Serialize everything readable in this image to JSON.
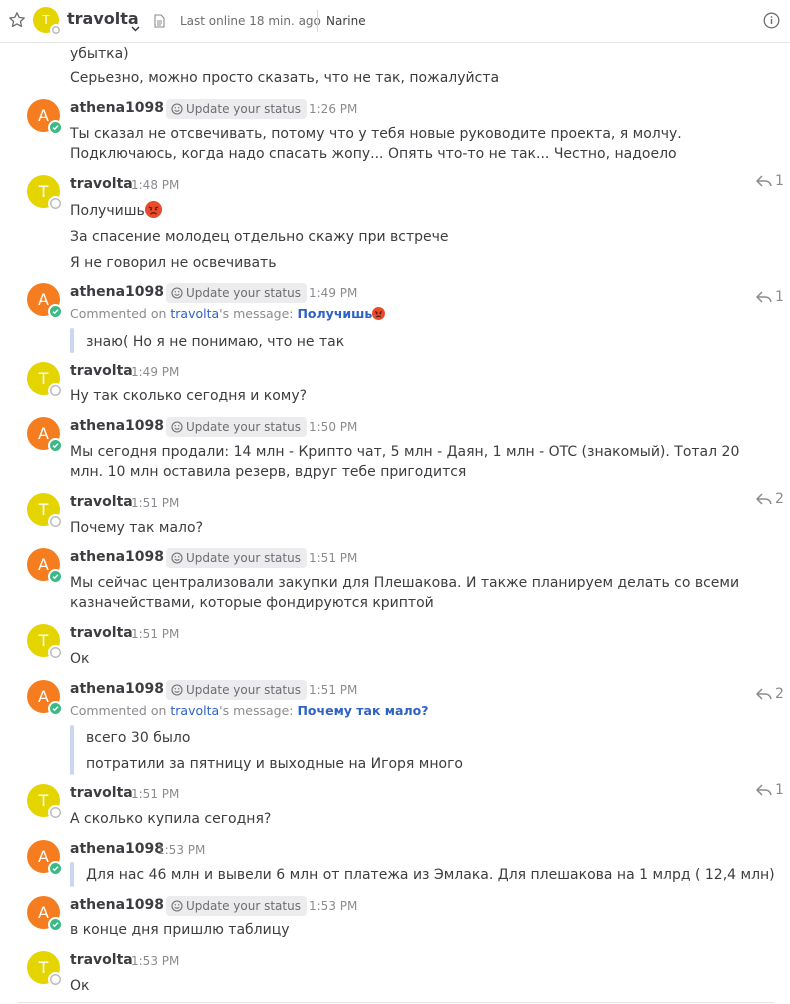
{
  "header": {
    "channel_name": "travolta",
    "avatar_letter": "T",
    "last_online": "Last online 18 min. ago",
    "user_name": "Narine"
  },
  "colors": {
    "athena_avatar": "#f57c1f",
    "travolta_avatar": "#e4d400",
    "online_status": "#3db887",
    "link": "#2f62c5",
    "quote_bar": "#c9d7f0"
  },
  "icons": {
    "favorite": "star-icon",
    "dropdown": "chevron-down-icon",
    "files": "file-icon",
    "info": "info-icon",
    "status": "smiley-icon",
    "reply": "reply-arrow-icon",
    "emoji": "angry-face-emoji"
  },
  "users": {
    "athena": {
      "name": "athena1098",
      "letter": "A",
      "status_chip": "Update your status"
    },
    "travolta": {
      "name": "travolta",
      "letter": "T"
    }
  },
  "messages": {
    "m0": {
      "line1": "убытка)",
      "line2": "Серьезно, можно просто сказать, что не так, пожалуйста"
    },
    "m1": {
      "time": "1:26 PM",
      "text": "Ты сказал не отсвечивать, потому что у тебя новые руководите проекта, я молчу. Подключаюсь, когда надо спасать жопу... Опять что-то не так... Честно, надоело"
    },
    "m2": {
      "time": "1:48 PM",
      "line1": "Получишь",
      "line2": "За спасение молодец отдельно скажу при встрече",
      "line3": "Я не говорил не освечивать",
      "replies": "1"
    },
    "m3": {
      "time": "1:49 PM",
      "commented_prefix": "Commented on ",
      "commented_user": "travolta",
      "commented_suffix": "'s message: ",
      "commented_msg": "Получишь",
      "text": "знаю( Но я не понимаю, что не так",
      "replies": "1"
    },
    "m4": {
      "time": "1:49 PM",
      "text": "Ну так сколько сегодня и кому?"
    },
    "m5": {
      "time": "1:50 PM",
      "text": "Мы сегодня продали: 14 млн - Крипто чат, 5 млн - Даян, 1 млн - OTC (знакомый). Тотал 20 млн. 10 млн оставила резерв, вдруг тебе пригодится"
    },
    "m6": {
      "time": "1:51 PM",
      "text": "Почему так мало?",
      "replies": "2"
    },
    "m7": {
      "time": "1:51 PM",
      "text": "Мы сейчас централизовали закупки для Плешакова. И также планируем делать со всеми казначействами, которые фондируются криптой"
    },
    "m8": {
      "time": "1:51 PM",
      "text": "Ок"
    },
    "m9": {
      "time": "1:51 PM",
      "commented_prefix": "Commented on ",
      "commented_user": "travolta",
      "commented_suffix": "'s message: ",
      "commented_msg": "Почему так мало?",
      "line1": "всего 30 было",
      "line2": "потратили за пятницу и выходные на Игоря много",
      "replies": "2"
    },
    "m10": {
      "time": "1:51 PM",
      "text": "А сколько купила сегодня?",
      "replies": "1"
    },
    "m11": {
      "time": "1:53 PM",
      "text": "Для нас 46 млн и вывели 6 млн от платежа из Эмлака. Для плешакова на 1 млрд ( 12,4 млн)"
    },
    "m12": {
      "time": "1:53 PM",
      "text": "в конце дня пришлю таблицу"
    },
    "m13": {
      "time": "1:53 PM",
      "text": "Ок"
    }
  }
}
